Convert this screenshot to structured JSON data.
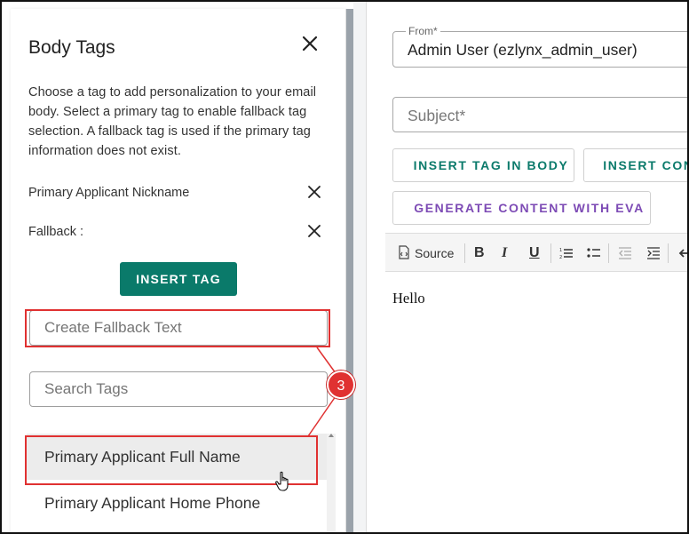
{
  "left_panel": {
    "title": "Body Tags",
    "description": "Choose a tag to add personalization to your email body. Select a primary tag to enable fallback tag selection. A fallback tag is used if the primary tag information does not exist.",
    "primary_tag_label": "Primary Applicant Nickname",
    "fallback_label": "Fallback :",
    "insert_tag_button": "INSERT TAG",
    "fallback_input_placeholder": "Create Fallback Text",
    "search_input_placeholder": "Search Tags",
    "tag_list": [
      "Primary Applicant Full Name",
      "Primary Applicant Home Phone"
    ]
  },
  "callout": {
    "number": "3",
    "color": "#e03131"
  },
  "right_panel": {
    "from_label": "From*",
    "from_value": "Admin User (ezlynx_admin_user)",
    "subject_placeholder": "Subject*",
    "insert_tag_in_body_button": "INSERT TAG IN BODY",
    "insert_content_button": "INSERT CONT",
    "generate_eva_button": "GENERATE CONTENT WITH EVA",
    "toolbar": {
      "source_label": "Source",
      "bold_label": "B",
      "italic_label": "I",
      "underline_label": "U"
    },
    "editor_body": "Hello"
  },
  "colors": {
    "primary_button": "#0a7a6a",
    "teal_text": "#0b7a6b",
    "purple_text": "#7d4bb5",
    "highlight_red": "#e03131"
  }
}
